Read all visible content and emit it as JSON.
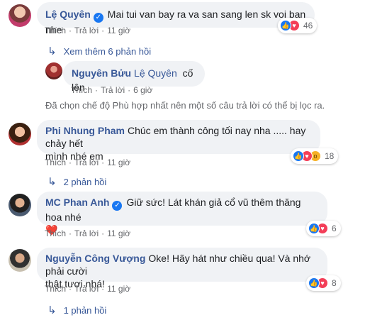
{
  "comments": [
    {
      "author": "Lệ Quyên",
      "verified": true,
      "text": "Mai tui van bay ra va san sang len sk voi ban nhe",
      "actions": {
        "like": "Thích",
        "reply": "Trả lời",
        "time": "11 giờ"
      },
      "reaction_count": "46",
      "more_replies": "Xem thêm 6 phản hồi"
    },
    {
      "author": "Nguyên Bửu",
      "mention": "Lệ Quyên",
      "text": "cố lên",
      "actions": {
        "like": "Thích",
        "reply": "Trả lời",
        "time": "6 giờ"
      }
    },
    {
      "author": "Phi Nhung Pham",
      "text_line1": "Chúc em thành công tối nay nha ..... hay chảy hết",
      "text_line2": "mình nhé em",
      "actions": {
        "like": "Thích",
        "reply": "Trả lời",
        "time": "11 giờ"
      },
      "reaction_count": "18",
      "more_replies": "2 phản hồi"
    },
    {
      "author": "MC Phan Anh",
      "verified": true,
      "text_line1": "Giữ sức! Lát khán giả cổ vũ thêm thăng hoa nhé",
      "emoji": "❤️",
      "actions": {
        "like": "Thích",
        "reply": "Trả lời",
        "time": "11 giờ"
      },
      "reaction_count": "6"
    },
    {
      "author": "Nguyễn Công Vượng",
      "text_line1": "Oke! Hãy hát như chiều qua! Và nhớ phải cười",
      "text_line2": "thật tươi nhá!",
      "actions": {
        "like": "Thích",
        "reply": "Trả lời",
        "time": "11 giờ"
      },
      "reaction_count": "8",
      "more_replies": "1 phản hồi"
    }
  ],
  "filter_notice": "Đã chọn chế độ Phù hợp nhất nên một số câu trả lời có thể bị lọc ra.",
  "icons": {
    "reply_arrow": "reply-arrow-icon",
    "like": "like-reaction-icon",
    "love": "love-reaction-icon",
    "wow": "wow-reaction-icon",
    "verified": "verified-badge-icon"
  },
  "colors": {
    "name": "#385898",
    "bubble": "#f0f2f5",
    "like": "#1877f2",
    "love": "#f33e58",
    "wow": "#f7b125",
    "meta": "#65676b"
  }
}
